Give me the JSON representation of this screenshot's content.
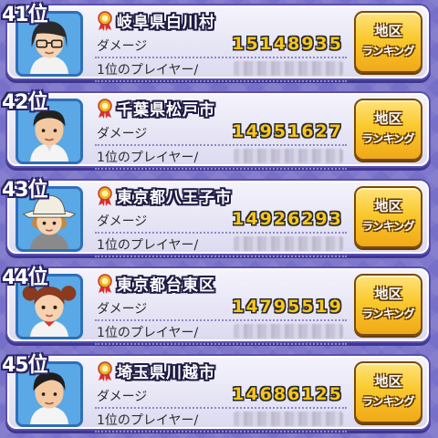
{
  "rows": [
    {
      "rank": "41位",
      "region": "岐阜県白川村",
      "damage_label": "ダメージ",
      "damage": "15148935",
      "player_label": "1位のプレイヤー/",
      "player_name": "",
      "button_line1": "地区",
      "button_line2": "ランキング"
    },
    {
      "rank": "42位",
      "region": "千葉県松戸市",
      "damage_label": "ダメージ",
      "damage": "14951627",
      "player_label": "1位のプレイヤー/",
      "player_name": "",
      "button_line1": "地区",
      "button_line2": "ランキング"
    },
    {
      "rank": "43位",
      "region": "東京都八王子市",
      "damage_label": "ダメージ",
      "damage": "14926293",
      "player_label": "1位のプレイヤー/",
      "player_name": "",
      "button_line1": "地区",
      "button_line2": "ランキング"
    },
    {
      "rank": "44位",
      "region": "東京都台東区",
      "damage_label": "ダメージ",
      "damage": "14795519",
      "player_label": "1位のプレイヤー/",
      "player_name": "",
      "button_line1": "地区",
      "button_line2": "ランキング"
    },
    {
      "rank": "45位",
      "region": "埼玉県川越市",
      "damage_label": "ダメージ",
      "damage": "14686125",
      "player_label": "1位のプレイヤー/",
      "player_name": "",
      "button_line1": "地区",
      "button_line2": "ランキング"
    }
  ],
  "colors": {
    "background": "#7770c8",
    "damage_text": "#f7c61e",
    "button_gold": "#f9c92d",
    "avatar_frame": "#5aa8e6"
  },
  "icons": {
    "ribbon": "award-ribbon-icon",
    "avatar": "player-avatar-icon"
  }
}
